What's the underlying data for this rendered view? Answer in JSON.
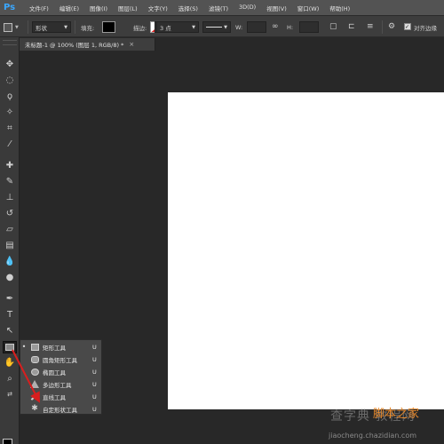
{
  "app": {
    "logo": "Ps"
  },
  "menu": [
    "文件(F)",
    "编辑(E)",
    "图像(I)",
    "图层(L)",
    "文字(Y)",
    "选择(S)",
    "滤镜(T)",
    "3D(D)",
    "视图(V)",
    "窗口(W)",
    "帮助(H)"
  ],
  "options": {
    "mode": "形状",
    "fill_label": "填充:",
    "fill_color": "#000000",
    "stroke_label": "描边:",
    "stroke_width": "3 点",
    "w_label": "W:",
    "h_label": "H:",
    "align_edges": "对齐边缘",
    "align_edges_checked": true
  },
  "document": {
    "tab_title": "未标题-1 @ 100% (图层 1, RGB/8) *",
    "close": "×"
  },
  "swatches": {
    "foreground": "#000000",
    "background": "#f5b100"
  },
  "flyout": {
    "items": [
      {
        "label": "矩形工具",
        "key": "U",
        "icon": "rectangle-icon",
        "selected": true
      },
      {
        "label": "圆角矩形工具",
        "key": "U",
        "icon": "rounded-rectangle-icon",
        "selected": false
      },
      {
        "label": "椭圆工具",
        "key": "U",
        "icon": "ellipse-icon",
        "selected": false
      },
      {
        "label": "多边形工具",
        "key": "U",
        "icon": "polygon-icon",
        "selected": false
      },
      {
        "label": "直线工具",
        "key": "U",
        "icon": "line-icon",
        "selected": false
      },
      {
        "label": "自定形状工具",
        "key": "U",
        "icon": "custom-shape-icon",
        "selected": false
      }
    ]
  },
  "watermark": {
    "text": "查字典 教程网",
    "brand": "脚本之家",
    "url": "jiaocheng.chazidian.com"
  }
}
